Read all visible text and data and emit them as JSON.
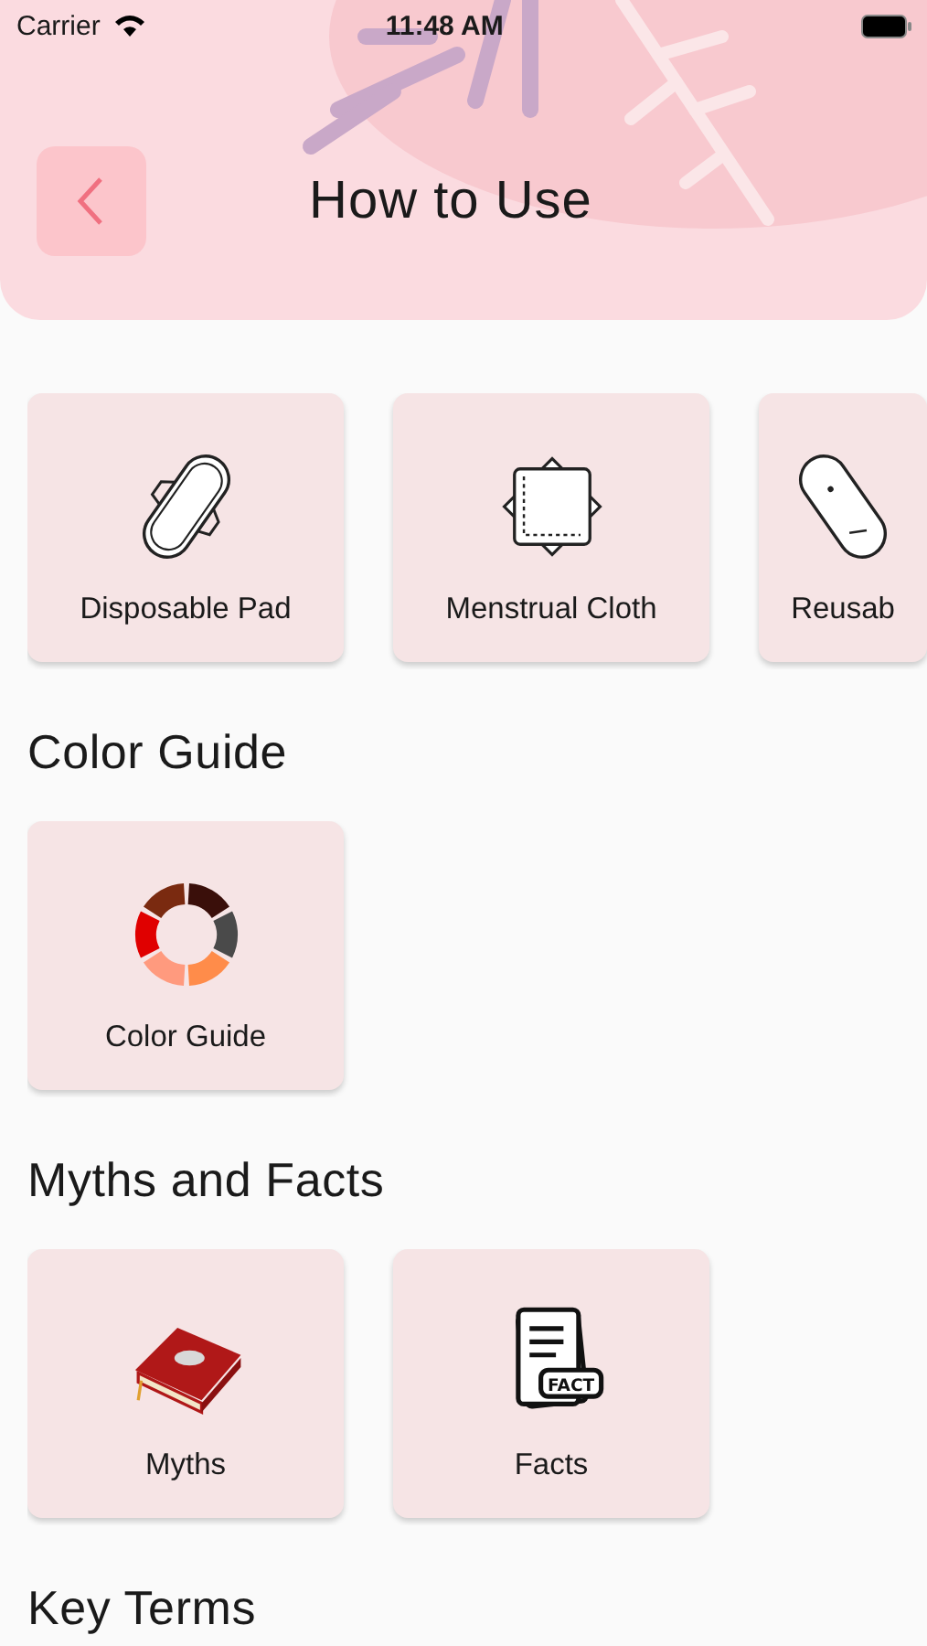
{
  "status_bar": {
    "carrier": "Carrier",
    "time": "11:48 AM"
  },
  "header": {
    "title": "How to Use"
  },
  "sections": [
    {
      "cards": [
        {
          "kind": "pad",
          "label": "Disposable Pad"
        },
        {
          "kind": "cloth",
          "label": "Menstrual Cloth"
        },
        {
          "kind": "reusable",
          "label": "Reusab"
        }
      ]
    },
    {
      "title": "Color Guide",
      "cards": [
        {
          "kind": "wheel",
          "label": "Color Guide"
        }
      ]
    },
    {
      "title": "Myths and Facts",
      "cards": [
        {
          "kind": "book",
          "label": "Myths"
        },
        {
          "kind": "fact",
          "label": "Facts",
          "badge": "FACT"
        }
      ]
    },
    {
      "title": "Key Terms"
    }
  ]
}
